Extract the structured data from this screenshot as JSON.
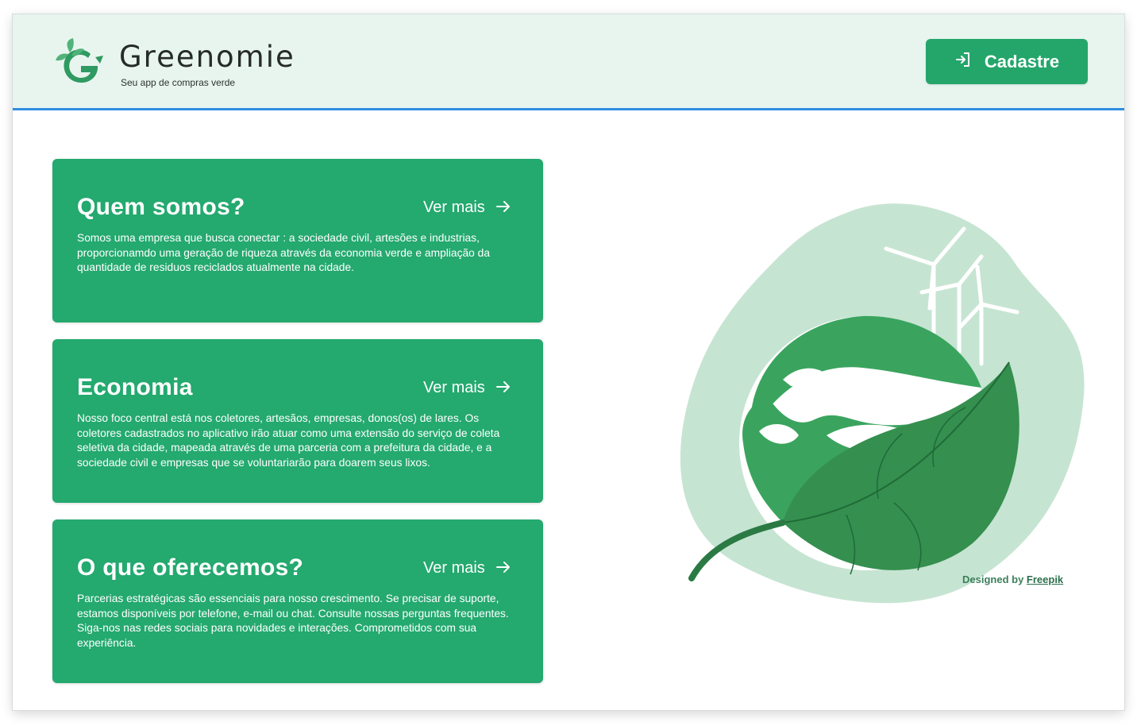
{
  "brand": {
    "name": "Greenomie",
    "tagline": "Seu app de compras verde"
  },
  "header": {
    "cadastre_label": "Cadastre"
  },
  "cards": [
    {
      "title": "Quem somos?",
      "more_label": "Ver mais",
      "body": "Somos uma empresa que busca conectar : a sociedade civil, artesões e industrias, proporcionamdo uma geração de riqueza através da economia verde e ampliação da quantidade de residuos reciclados atualmente na cidade."
    },
    {
      "title": "Economia",
      "more_label": "Ver mais",
      "body": "Nosso foco central está nos coletores, artesãos, empresas, donos(os) de lares. Os coletores cadastrados no aplicativo irão atuar como uma extensão do serviço de coleta seletiva da cidade, mapeada através de uma parceria com a prefeitura da cidade, e a sociedade civil e empresas que se voluntariarão para doarem seus lixos."
    },
    {
      "title": "O que oferecemos?",
      "more_label": "Ver mais",
      "body": "Parcerias estratégicas são essenciais para nosso crescimento. Se precisar de suporte, estamos disponíveis por telefone, e-mail ou chat. Consulte nossas perguntas frequentes. Siga-nos nas redes sociais para novidades e interações. Comprometidos com sua experiência."
    }
  ],
  "credit": {
    "prefix": "Designed by",
    "link": "Freepik"
  },
  "colors": {
    "primary": "#24a96f",
    "header_bg": "#e8f5ef",
    "header_border": "#2f8ee0"
  },
  "icons": {
    "logo": "leaf-g-logo-icon",
    "login": "login-arrow-icon",
    "arrow": "arrow-right-icon"
  }
}
